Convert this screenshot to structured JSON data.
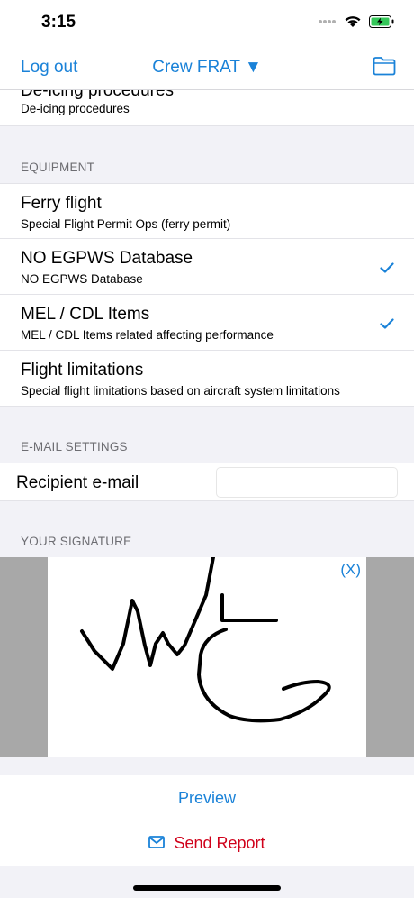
{
  "status": {
    "time": "3:15"
  },
  "nav": {
    "left": "Log out",
    "title": "Crew FRAT ▼",
    "right_icon": "folder-icon"
  },
  "top_cell": {
    "title": "De-icing procedures",
    "subtitle": "De-icing procedures"
  },
  "equipment": {
    "header": "EQUIPMENT",
    "items": [
      {
        "title": "Ferry flight",
        "subtitle": "Special Flight Permit Ops (ferry permit)",
        "checked": false
      },
      {
        "title": "NO EGPWS Database",
        "subtitle": "NO EGPWS Database",
        "checked": true
      },
      {
        "title": "MEL / CDL Items",
        "subtitle": "MEL / CDL Items related affecting performance",
        "checked": true
      },
      {
        "title": "Flight limitations",
        "subtitle": "Special flight limitations based on aircraft system limitations",
        "checked": false
      }
    ]
  },
  "email": {
    "header": "E-MAIL SETTINGS",
    "label": "Recipient e-mail",
    "value": "",
    "placeholder": ""
  },
  "signature": {
    "header": "YOUR SIGNATURE",
    "clear_label": "(X)"
  },
  "actions": {
    "preview": "Preview",
    "send": "Send Report"
  },
  "colors": {
    "accent": "#1a82d8",
    "send": "#d0021b"
  }
}
